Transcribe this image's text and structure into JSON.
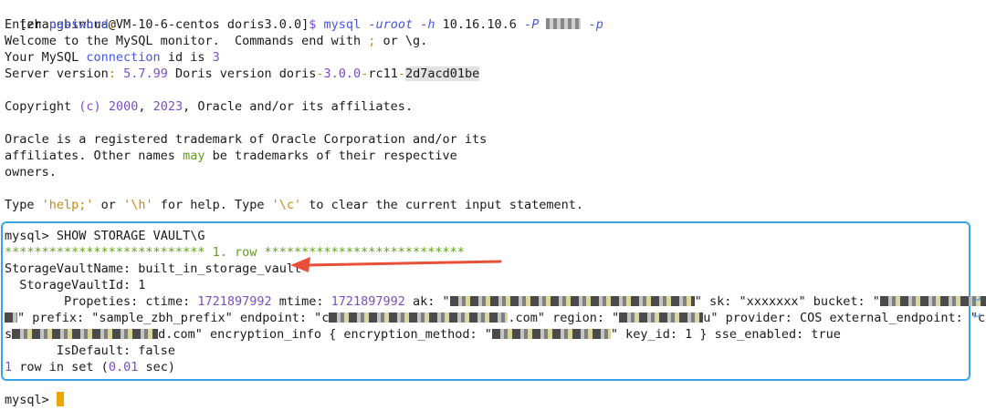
{
  "prompt": {
    "user_host": "[zhangbinhua@VM-10-6-centos doris3.0.0]",
    "dollar": "$",
    "cmd": "mysql",
    "flag_u": "-uroot",
    "flag_h": "-h",
    "host": "10.16.10.6",
    "flag_P": "-P",
    "flag_p": "-p"
  },
  "welcome": {
    "enter": "Enter ",
    "password": "password",
    "colon": ":",
    "welcome_a": "Welcome to the MySQL monitor.  Commands end with ",
    "semicolon": ";",
    "welcome_b": " or \\g.",
    "conn_a": "Your MySQL ",
    "conn_word": "connection",
    "conn_b": " id is ",
    "conn_id": "3",
    "server_label": "Server version",
    "server_colon": ": ",
    "server_num": "5.7.99",
    "server_rest": " Doris version doris",
    "server_dash": "-",
    "server_ver": "3.0.0",
    "server_dash2": "-",
    "server_rc": "rc11",
    "server_dash3": "-",
    "server_hash": "2d7acd01be"
  },
  "copyright": {
    "a": "Copyright ",
    "c": "(c)",
    "space": " ",
    "y1": "2000",
    "comma": ", ",
    "y2": "2023",
    "b": ", Oracle and/or its affiliates."
  },
  "trademark": {
    "l1": "Oracle is a registered trademark of Oracle Corporation and/or its",
    "l2a": "affiliates. Other names ",
    "may": "may",
    "l2b": " be trademarks of their respective",
    "l3": "owners."
  },
  "help": {
    "a": "Type ",
    "q1": "'help;'",
    "b": " or ",
    "q2": "'\\h'",
    "c": " for help. Type ",
    "q3": "'\\c'",
    "d": " to clear the current input statement."
  },
  "query": {
    "prompt": "mysql>",
    "cmd": " SHOW STORAGE VAULT\\G",
    "row_header": "*************************** 1. row ***************************",
    "f1_label": "StorageVaultName",
    "f1_value": ": built_in_storage_vault",
    "f2_label": "  StorageVaultId",
    "f2_value": ": 1",
    "f3_label": "        Propeties",
    "f3_a": ": ctime: ",
    "ctime": "1721897992",
    "f3_b": " mtime: ",
    "mtime": "1721897992",
    "f3_c": " ak: \"",
    "f3_d": "\" sk: \"xxxxxxx\" bucket: \"",
    "f3_e": "?",
    "l2_a": "\" prefix: \"sample_zbh_prefix\" endpoint: \"c",
    "l2_b": ".com\" region: \"",
    "l2_c": "u\" provider: COS external_endpoint: \"co",
    "l3_a": "s",
    "l3_b": "d.com\" encryption_info { encryption_method: \"",
    "l3_c": "\" key_id: 1 } sse_enabled: true",
    "f4_label": "       IsDefault",
    "f4_value": ": false",
    "summary_a": "1",
    "summary_b": " row in set (",
    "summary_c": "0.01",
    "summary_d": " sec)"
  },
  "final_prompt": "mysql>",
  "colors": {
    "frame": "#3aa3e8",
    "arrow": "#e8503a",
    "caret": "#f0a400"
  }
}
